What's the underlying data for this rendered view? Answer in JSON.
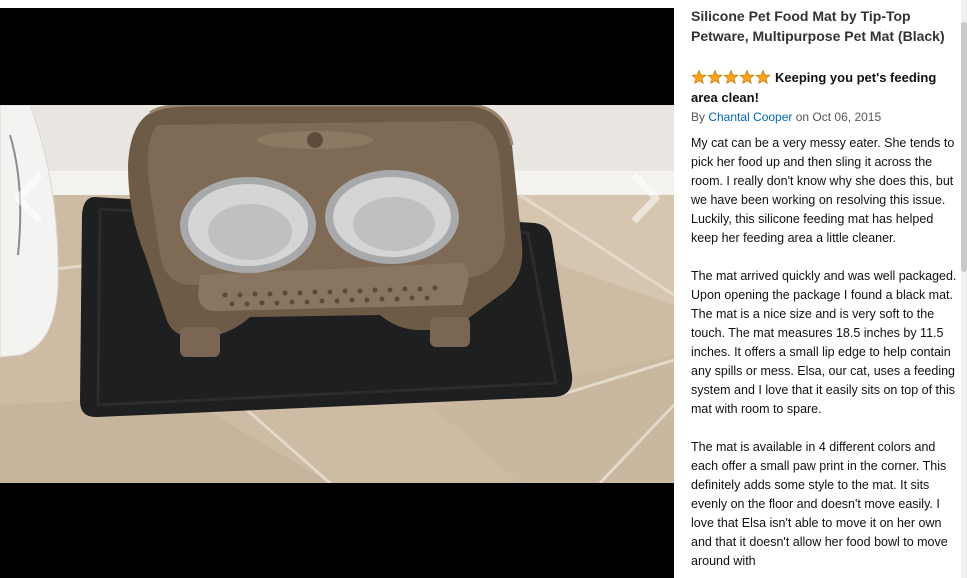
{
  "viewer": {
    "image_alt": "Elevated pet feeder with two stainless steel bowls on a black silicone mat",
    "prev_icon": "chevron-left-icon",
    "next_icon": "chevron-right-icon"
  },
  "product": {
    "title": "Silicone Pet Food Mat by Tip-Top Petware, Multipurpose Pet Mat (Black)"
  },
  "review": {
    "rating": 5,
    "rating_max": 5,
    "star_color": "#ffa41c",
    "headline": "Keeping you pet's feeding area clean!",
    "by_prefix": "By ",
    "author": "Chantal Cooper",
    "date_text": " on Oct 06, 2015",
    "paragraphs": [
      "My cat can be a very messy eater. She tends to pick her food up and then sling it across the room. I really don't know why she does this, but we have been working on resolving this issue. Luckily, this silicone feeding mat has helped keep her feeding area a little cleaner.",
      "The mat arrived quickly and was well packaged. Upon opening the package I found a black mat. The mat is a nice size and is very soft to the touch. The mat measures 18.5 inches by 11.5 inches. It offers a small lip edge to help contain any spills or mess. Elsa, our cat, uses a feeding system and I love that it easily sits on top of this mat with room to spare.",
      "The mat is available in 4 different colors and each offer a small paw print in the corner. This definitely adds some style to the mat. It sits evenly on the floor and doesn't move easily. I love that Elsa isn't able to move it on her own and that it doesn't allow her food bowl to move around with"
    ]
  },
  "colors": {
    "link": "#0066c0",
    "viewer_bg": "#000000"
  }
}
